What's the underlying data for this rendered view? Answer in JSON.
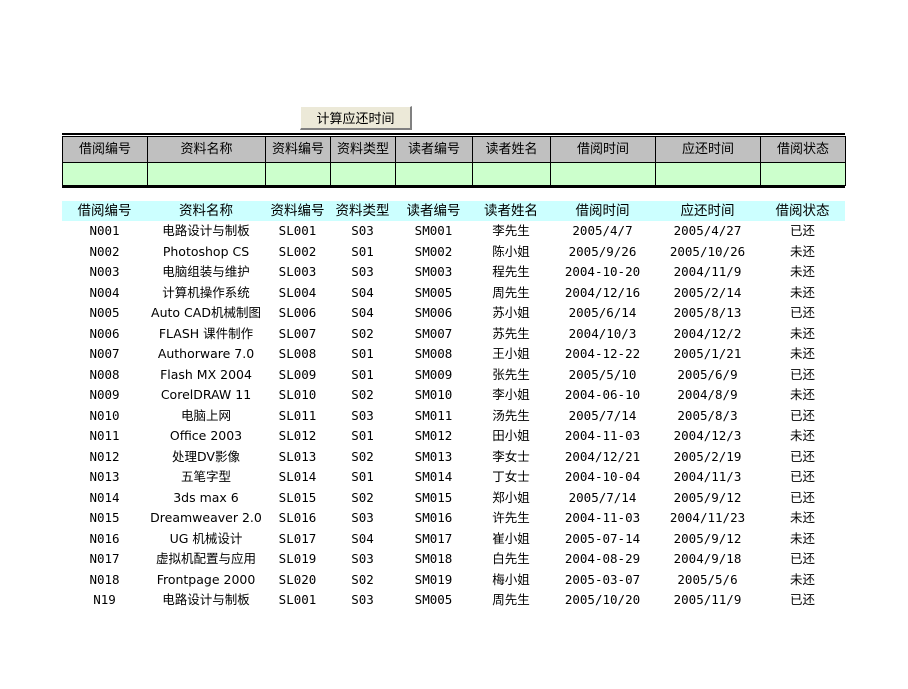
{
  "toolbar": {
    "calc_button_label": "计算应还时间"
  },
  "entry_form": {
    "headers": [
      "借阅编号",
      "资料名称",
      "资料编号",
      "资料类型",
      "读者编号",
      "读者姓名",
      "借阅时间",
      "应还时间",
      "借阅状态"
    ],
    "values": [
      "",
      "",
      "",
      "",
      "",
      "",
      "",
      "",
      ""
    ],
    "header_bg": "#c0c0c0",
    "input_bg": "#ccffcc"
  },
  "data_table": {
    "header_bg": "#ccffff",
    "headers": [
      "借阅编号",
      "资料名称",
      "资料编号",
      "资料类型",
      "读者编号",
      "读者姓名",
      "借阅时间",
      "应还时间",
      "借阅状态"
    ],
    "rows": [
      [
        "N001",
        "电路设计与制板",
        "SL001",
        "S03",
        "SM001",
        "李先生",
        "2005/4/7",
        "2005/4/27",
        "已还"
      ],
      [
        "N002",
        "Photoshop CS",
        "SL002",
        "S01",
        "SM002",
        "陈小姐",
        "2005/9/26",
        "2005/10/26",
        "未还"
      ],
      [
        "N003",
        "电脑组装与维护",
        "SL003",
        "S03",
        "SM003",
        "程先生",
        "2004-10-20",
        "2004/11/9",
        "未还"
      ],
      [
        "N004",
        "计算机操作系统",
        "SL004",
        "S04",
        "SM005",
        "周先生",
        "2004/12/16",
        "2005/2/14",
        "未还"
      ],
      [
        "N005",
        "Auto CAD机械制图",
        "SL006",
        "S04",
        "SM006",
        "苏小姐",
        "2005/6/14",
        "2005/8/13",
        "已还"
      ],
      [
        "N006",
        "FLASH 课件制作",
        "SL007",
        "S02",
        "SM007",
        "苏先生",
        "2004/10/3",
        "2004/12/2",
        "未还"
      ],
      [
        "N007",
        "Authorware 7.0",
        "SL008",
        "S01",
        "SM008",
        "王小姐",
        "2004-12-22",
        "2005/1/21",
        "未还"
      ],
      [
        "N008",
        "Flash MX 2004",
        "SL009",
        "S01",
        "SM009",
        "张先生",
        "2005/5/10",
        "2005/6/9",
        "已还"
      ],
      [
        "N009",
        "CorelDRAW 11",
        "SL010",
        "S02",
        "SM010",
        "李小姐",
        "2004-06-10",
        "2004/8/9",
        "未还"
      ],
      [
        "N010",
        "电脑上网",
        "SL011",
        "S03",
        "SM011",
        "汤先生",
        "2005/7/14",
        "2005/8/3",
        "已还"
      ],
      [
        "N011",
        "Office 2003",
        "SL012",
        "S01",
        "SM012",
        "田小姐",
        "2004-11-03",
        "2004/12/3",
        "未还"
      ],
      [
        "N012",
        "处理DV影像",
        "SL013",
        "S02",
        "SM013",
        "李女士",
        "2004/12/21",
        "2005/2/19",
        "已还"
      ],
      [
        "N013",
        "五笔字型",
        "SL014",
        "S01",
        "SM014",
        "丁女士",
        "2004-10-04",
        "2004/11/3",
        "已还"
      ],
      [
        "N014",
        "3ds max 6",
        "SL015",
        "S02",
        "SM015",
        "郑小姐",
        "2005/7/14",
        "2005/9/12",
        "已还"
      ],
      [
        "N015",
        "Dreamweaver 2.0",
        "SL016",
        "S03",
        "SM016",
        "许先生",
        "2004-11-03",
        "2004/11/23",
        "未还"
      ],
      [
        "N016",
        "UG 机械设计",
        "SL017",
        "S04",
        "SM017",
        "崔小姐",
        "2005-07-14",
        "2005/9/12",
        "未还"
      ],
      [
        "N017",
        "虚拟机配置与应用",
        "SL019",
        "S03",
        "SM018",
        "白先生",
        "2004-08-29",
        "2004/9/18",
        "已还"
      ],
      [
        "N018",
        "Frontpage 2000",
        "SL020",
        "S02",
        "SM019",
        "梅小姐",
        "2005-03-07",
        "2005/5/6",
        "未还"
      ],
      [
        "N19",
        "电路设计与制板",
        "SL001",
        "S03",
        "SM005",
        "周先生",
        "2005/10/20",
        "2005/11/9",
        "已还"
      ]
    ]
  }
}
